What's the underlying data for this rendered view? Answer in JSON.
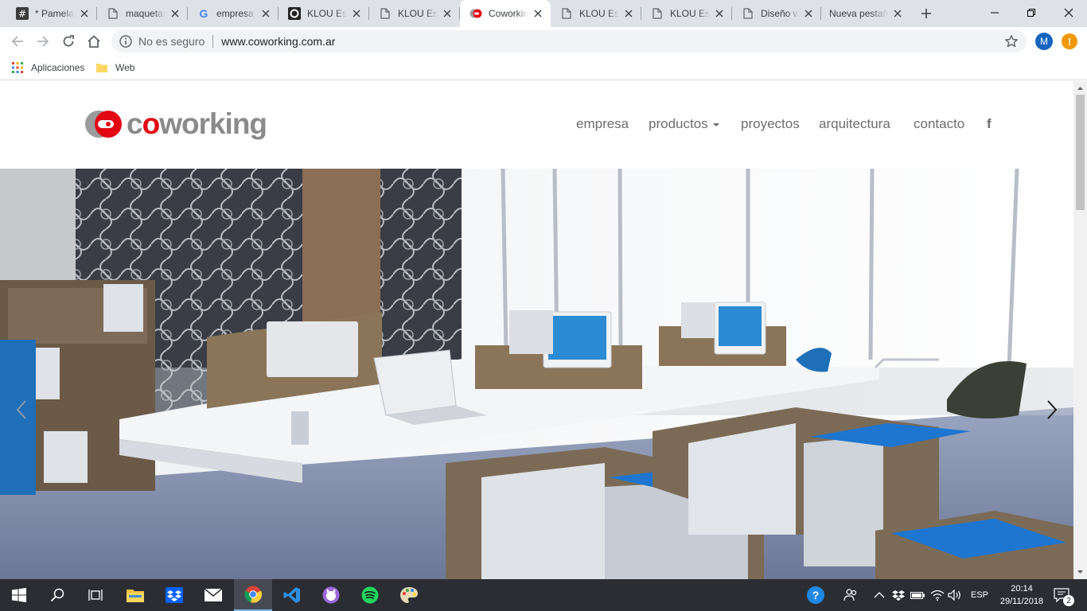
{
  "browser": {
    "tabs": [
      {
        "title": "* Pamela",
        "icon": "hashtag-icon"
      },
      {
        "title": "maquetado",
        "icon": "document-icon"
      },
      {
        "title": "empresa",
        "icon": "google-icon"
      },
      {
        "title": "KLOU Estudio",
        "icon": "klou-icon"
      },
      {
        "title": "KLOU Estudio",
        "icon": "document-icon"
      },
      {
        "title": "Coworking",
        "icon": "coworking-icon",
        "active": true
      },
      {
        "title": "KLOU Estudio",
        "icon": "document-icon"
      },
      {
        "title": "KLOU Estudio",
        "icon": "document-icon"
      },
      {
        "title": "Diseño web",
        "icon": "document-icon"
      },
      {
        "title": "Nueva pestaña",
        "icon": "none"
      }
    ],
    "security_label": "No es seguro",
    "url": "www.coworking.com.ar",
    "profile_initial": "M",
    "alert_symbol": "!",
    "bookmarks": [
      {
        "label": "Aplicaciones",
        "icon": "apps-grid-icon"
      },
      {
        "label": "Web",
        "icon": "folder-icon"
      }
    ]
  },
  "site": {
    "logo_text_pre": "c",
    "logo_text_o": "o",
    "logo_text_post": "working",
    "nav": {
      "empresa": "empresa",
      "productos": "productos",
      "proyectos": "proyectos",
      "arquitectura": "arquitectura",
      "contacto": "contacto",
      "facebook": "f"
    }
  },
  "taskbar": {
    "language": "ESP",
    "time": "20:14",
    "date": "29/11/2018",
    "notification_count": "2",
    "help_symbol": "?"
  },
  "colors": {
    "brand_red": "#e30613",
    "logo_gray": "#8a8a8a",
    "nav_text": "#6d6d6d",
    "taskbar": "#2b2d33"
  }
}
